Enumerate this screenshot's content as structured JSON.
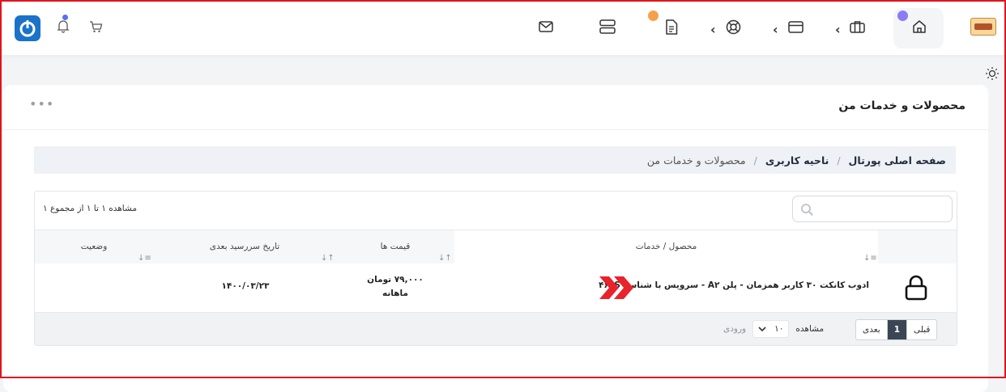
{
  "header": {
    "icons": [
      "home-icon",
      "briefcase-icon",
      "credit-card-icon",
      "lifebuoy-icon",
      "document-icon",
      "server-icon",
      "mail-icon",
      "cart-icon",
      "bell-icon"
    ],
    "badge_colors": {
      "home": "#8b7cf6",
      "document": "#f6a04d",
      "bell": "#5b6ef2"
    },
    "power_logo_color": "#1a73c9"
  },
  "page": {
    "title": "محصولات و خدمات من",
    "more_label": "•••"
  },
  "breadcrumb": {
    "items": [
      "صفحه اصلی پورتال",
      "ناحیه کاربری",
      "محصولات و خدمات من"
    ],
    "separator": "/"
  },
  "table": {
    "search_placeholder": "",
    "showing_text": "مشاهده ۱ تا ۱ از مجموع ۱",
    "columns": [
      "محصول / خدمات",
      "قیمت ها",
      "تاریخ سررسید بعدی",
      "وضعیت"
    ],
    "rows": [
      {
        "product": "ادوب کانکت ۳۰ کاربر همزمان - پلن A۲ - سرویس با شناسه ۴۶۳S",
        "price": "۷۹,۰۰۰ تومان",
        "cycle": "ماهانه",
        "next_due": "۱۴۰۰/۰۳/۲۳",
        "status": ""
      }
    ],
    "footer": {
      "prev_label": "قبلی",
      "current_page": "1",
      "next_label": "بعدی",
      "show_label": "مشاهده",
      "per_page": "۱۰",
      "entries_label": "ورودی"
    }
  },
  "colors": {
    "accent_red": "#e0151c",
    "arrow_red": "#e8232b"
  }
}
